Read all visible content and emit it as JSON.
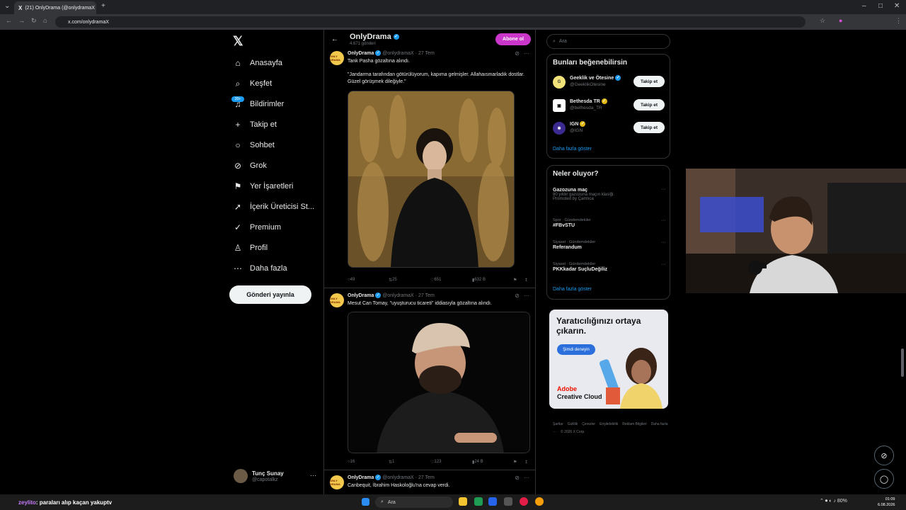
{
  "browser": {
    "tab_title": "(21) OnlyDrama (@onlydramaX",
    "url": "x.com/onlydramaX"
  },
  "nav": {
    "items": [
      {
        "icon": "home-icon",
        "glyph": "⌂",
        "label": "Anasayfa"
      },
      {
        "icon": "search-icon",
        "glyph": "⌕",
        "label": "Keşfet"
      },
      {
        "icon": "bell-icon",
        "glyph": "♫",
        "label": "Bildirimler"
      },
      {
        "icon": "follow-icon",
        "glyph": "+",
        "label": "Takip et"
      },
      {
        "icon": "chat-icon",
        "glyph": "○",
        "label": "Sohbet"
      },
      {
        "icon": "grok-icon",
        "glyph": "⊘",
        "label": "Grok"
      },
      {
        "icon": "bookmark-icon",
        "glyph": "⚑",
        "label": "Yer İşaretleri"
      },
      {
        "icon": "rocket-icon",
        "glyph": "➚",
        "label": "İçerik Üreticisi St..."
      },
      {
        "icon": "premium-icon",
        "glyph": "✓",
        "label": "Premium"
      },
      {
        "icon": "profile-icon",
        "glyph": "♙",
        "label": "Profil"
      },
      {
        "icon": "more-icon",
        "glyph": "⋯",
        "label": "Daha fazla"
      }
    ],
    "notif_badge": "20+",
    "post_button": "Gönderi yayınla",
    "account_name": "Tunç Sunay",
    "account_handle": "@capotalkz"
  },
  "profile_header": {
    "name": "OnlyDrama",
    "post_count": "4.671 gönderi",
    "subscribe": "Abone ol"
  },
  "tweets": [
    {
      "name": "OnlyDrama",
      "handle": "@onlydramaX · 27 Tem",
      "text": "Tank Pasha gözaltına alındı.",
      "quote": "\"Jandarma tarafından götürülüyorum, kapıma gelmişler. Allahaısmarladık dostlar. Güzel görüşmek dileğiyle.\"",
      "replies": "49",
      "reposts": "25",
      "likes": "651",
      "views": "632 B"
    },
    {
      "name": "OnlyDrama",
      "handle": "@onlydramaX · 27 Tem",
      "text": "Mesut Can Tomay, \"uyuşturucu ticareti\" iddiasıyla gözaltına alındı.",
      "replies": "16",
      "reposts": "1",
      "likes": "123",
      "views": "24 B"
    },
    {
      "name": "OnlyDrama",
      "handle": "@onlydramaX · 27 Tem",
      "text": "Canbequit, İbrahim Haskoloğlu'na cevap verdi."
    }
  ],
  "sidebar": {
    "search_placeholder": "Ara",
    "suggestions_title": "Bunları beğenebilirsin",
    "suggestions": [
      {
        "name": "Geeklik ve Ötesine",
        "handle": "@GeeklikOtesine",
        "button": "Takip et"
      },
      {
        "name": "Bethesda TR",
        "handle": "@bethesda_TR",
        "button": "Takip et"
      },
      {
        "name": "IGN",
        "handle": "@IGN",
        "button": "Takip et"
      }
    ],
    "show_more": "Daha fazla göster",
    "trends_title": "Neler oluyor?",
    "trends": [
      {
        "category": "",
        "title": "Gazozuna maç",
        "sub": "80 yıldır gazozuna maçın klasiği.",
        "promo": "Promoted by Çamlıca"
      },
      {
        "category": "Spor · Gündemdekiler",
        "title": "#FBvSTU",
        "sub": "",
        "promo": ""
      },
      {
        "category": "Siyaset · Gündemdekiler",
        "title": "Referandum",
        "sub": "",
        "promo": ""
      },
      {
        "category": "Siyaset · Gündemdekiler",
        "title": "PKKkadar SuçluDeğiliz",
        "sub": "",
        "promo": ""
      }
    ],
    "show_more_2": "Daha fazla göster",
    "ad": {
      "headline": "Yaratıcılığınızı ortaya çıkarın.",
      "cta": "Şimdi deneyin",
      "brand_line1": "Adobe",
      "brand_line2": "Creative Cloud"
    },
    "footer_links": [
      "Şartlar",
      "Gizlilik",
      "Çerezler",
      "Erişilebilirlik",
      "Reklam Bilgileri",
      "Daha fazla ···",
      "© 2026 X Corp."
    ]
  },
  "overlay": {
    "chat_user": "zeylito",
    "chat_message": ": paraları alıp kaçan yakuptv"
  },
  "taskbar": {
    "search": "Ara",
    "battery": "80%",
    "time": "01:09",
    "date": "6.08.2026"
  }
}
